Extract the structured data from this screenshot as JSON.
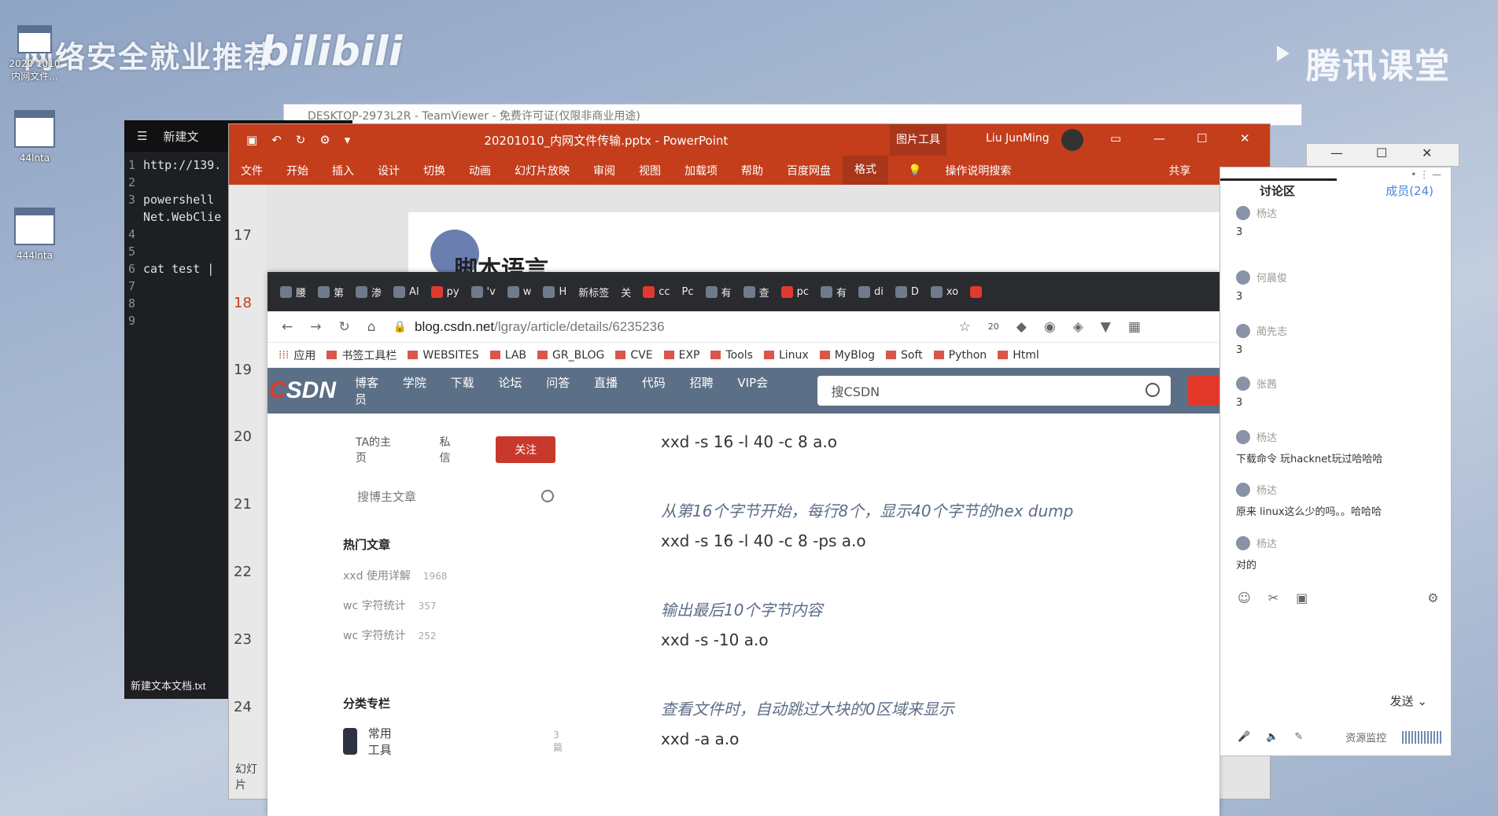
{
  "watermark": {
    "left_text": "网络安全就业推荐",
    "bili": "bilibili",
    "right_text": "腾讯课堂"
  },
  "desktop": {
    "icons": [
      {
        "label": "2020 1010 内网文件..."
      },
      {
        "label": "44lnta"
      },
      {
        "label": "444lnta"
      }
    ]
  },
  "teamviewer": {
    "title": "DESKTOP-2973L2R - TeamViewer - 免费许可证(仅限非商业用途)"
  },
  "editor": {
    "title": "新建文",
    "lines": [
      {
        "n": "1",
        "t": "http://139."
      },
      {
        "n": "2",
        "t": ""
      },
      {
        "n": "3",
        "t": "powershell"
      },
      {
        "n": "",
        "t": "Net.WebClie"
      },
      {
        "n": "4",
        "t": ""
      },
      {
        "n": "5",
        "t": ""
      },
      {
        "n": "6",
        "t": "cat test |"
      },
      {
        "n": "7",
        "t": ""
      },
      {
        "n": "8",
        "t": ""
      },
      {
        "n": "9",
        "t": ""
      }
    ],
    "footer": "新建文本文档.txt"
  },
  "ppt": {
    "doc_title": "20201010_内网文件传输.pptx - PowerPoint",
    "picture_tools": "图片工具",
    "user": "Liu JunMing",
    "ribbon": [
      "文件",
      "开始",
      "插入",
      "设计",
      "切换",
      "动画",
      "幻灯片放映",
      "审阅",
      "视图",
      "加载项",
      "帮助",
      "百度网盘",
      "格式"
    ],
    "tell_me": "操作说明搜索",
    "share": "共享",
    "slide_numbers": [
      "17",
      "18",
      "19",
      "20",
      "21",
      "22",
      "23",
      "24"
    ],
    "slide_heading": "脚本语言",
    "status": "幻灯片"
  },
  "browser": {
    "tabs": [
      "腰",
      "第",
      "渗",
      "Al",
      "py",
      "'v",
      "w",
      "H",
      "新标签",
      "关",
      "cc",
      "Pc",
      "有",
      "查",
      "pc",
      "有",
      "di",
      "D",
      "xo"
    ],
    "url_host": "blog.csdn.net",
    "url_path": "/lgray/article/details/6235236",
    "bookmarks": [
      "应用",
      "书签工具栏",
      "WEBSITES",
      "LAB",
      "GR_BLOG",
      "CVE",
      "EXP",
      "Tools",
      "Linux",
      "MyBlog",
      "Soft",
      "Python",
      "Html"
    ],
    "csdn_nav": [
      "博客",
      "学院",
      "下载",
      "论坛",
      "问答",
      "直播",
      "代码",
      "招聘",
      "VIP会员"
    ],
    "search_placeholder": "搜CSDN",
    "badge": "20"
  },
  "blog": {
    "ta_home": "TA的主页",
    "message": "私信",
    "follow": "关注",
    "search": "搜博主文章",
    "hot_title": "热门文章",
    "hot": [
      {
        "title": "xxd 使用详解",
        "views": "1968"
      },
      {
        "title": "wc 字符统计",
        "views": "357"
      },
      {
        "title": "wc 字符统计",
        "views": "252"
      }
    ],
    "category_title": "分类专栏",
    "category": {
      "name": "常用工具",
      "count": "3篇"
    }
  },
  "article": {
    "l1": "xxd -s 16 -l 40 -c 8 a.o",
    "l2": "从第16个字节开始，每行8个，显示40个字节的hex dump",
    "l3": "xxd -s 16 -l 40 -c 8 -ps a.o",
    "l4": "输出最后10个字节内容",
    "l5": "xxd -s -10 a.o",
    "l6": "查看文件时，自动跳过大块的0区域来显示",
    "l7": "xxd -a a.o"
  },
  "discussion": {
    "tab": "讨论区",
    "members": "成员(24)",
    "messages": [
      {
        "name": "杨达",
        "text": "3"
      },
      {
        "name": "何晨俊",
        "text": "3"
      },
      {
        "name": "蔺先志",
        "text": "3"
      },
      {
        "name": "张茜",
        "text": "3"
      },
      {
        "name": "杨达",
        "text": "下载命令 玩hacknet玩过哈哈哈"
      },
      {
        "name": "杨达",
        "text": "原来 linux这么少的吗。。哈哈哈"
      },
      {
        "name": "杨达",
        "text": "对的"
      }
    ],
    "send": "发送",
    "monitor": "资源监控"
  }
}
